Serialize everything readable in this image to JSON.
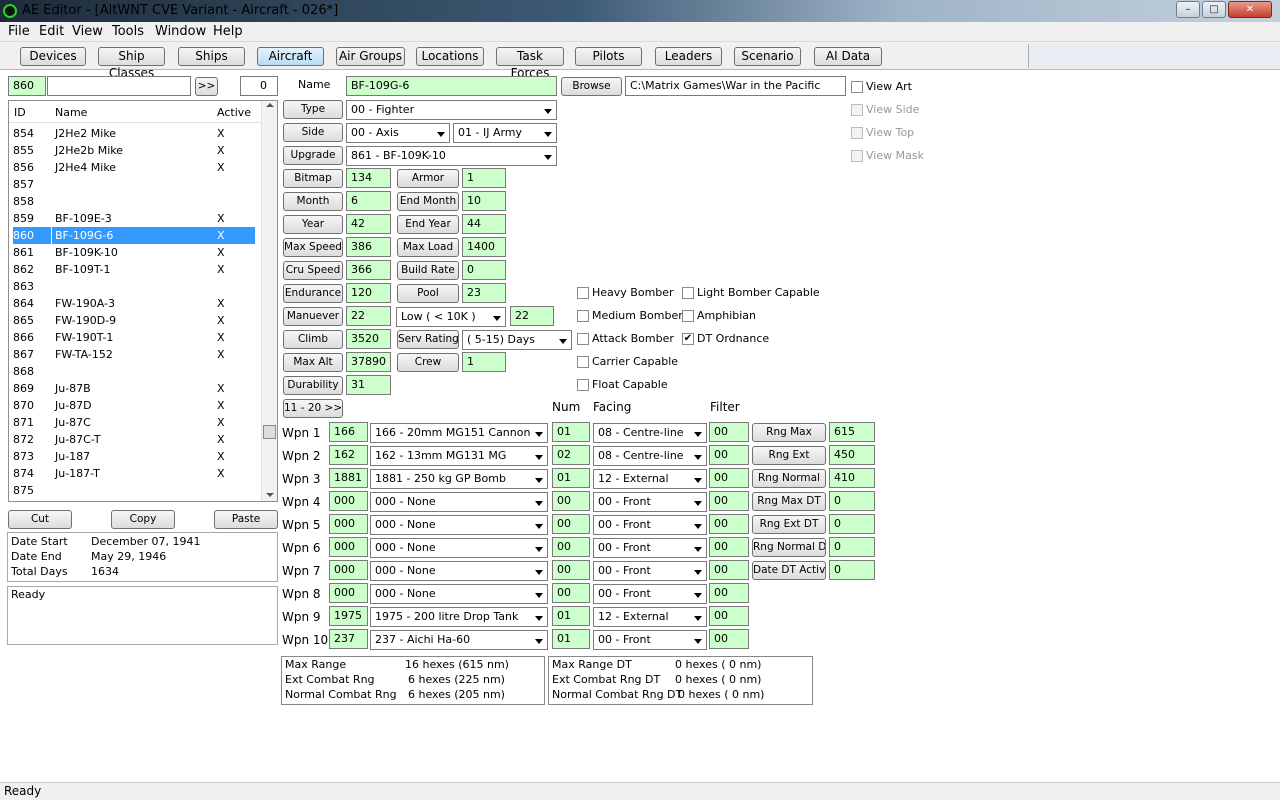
{
  "window": {
    "title": "AE Editor - [AltWNT CVE Variant - Aircraft - 026*]"
  },
  "menu": [
    "File",
    "Edit",
    "View",
    "Tools",
    "Window",
    "Help"
  ],
  "toolbar": [
    "Devices",
    "Ship Classes",
    "Ships",
    "Aircraft",
    "Air Groups",
    "Locations",
    "Task Forces",
    "Pilots",
    "Leaders",
    "Scenario",
    "AI Data"
  ],
  "toolbar_active": "Aircraft",
  "search": {
    "id_value": "860",
    "text": "",
    "go_label": ">>",
    "count": "0"
  },
  "list": {
    "headers": [
      "ID",
      "Name",
      "Active"
    ],
    "rows": [
      {
        "id": "854",
        "name": "J2He2 Mike",
        "active": "X"
      },
      {
        "id": "855",
        "name": "J2He2b Mike",
        "active": "X"
      },
      {
        "id": "856",
        "name": "J2He4 Mike",
        "active": "X"
      },
      {
        "id": "857",
        "name": "",
        "active": ""
      },
      {
        "id": "858",
        "name": "",
        "active": ""
      },
      {
        "id": "859",
        "name": "BF-109E-3",
        "active": "X"
      },
      {
        "id": "860",
        "name": "BF-109G-6",
        "active": "X"
      },
      {
        "id": "861",
        "name": "BF-109K-10",
        "active": "X"
      },
      {
        "id": "862",
        "name": "BF-109T-1",
        "active": "X"
      },
      {
        "id": "863",
        "name": "",
        "active": ""
      },
      {
        "id": "864",
        "name": "FW-190A-3",
        "active": "X"
      },
      {
        "id": "865",
        "name": "FW-190D-9",
        "active": "X"
      },
      {
        "id": "866",
        "name": "FW-190T-1",
        "active": "X"
      },
      {
        "id": "867",
        "name": "FW-TA-152",
        "active": "X"
      },
      {
        "id": "868",
        "name": "",
        "active": ""
      },
      {
        "id": "869",
        "name": "Ju-87B",
        "active": "X"
      },
      {
        "id": "870",
        "name": "Ju-87D",
        "active": "X"
      },
      {
        "id": "871",
        "name": "Ju-87C",
        "active": "X"
      },
      {
        "id": "872",
        "name": "Ju-87C-T",
        "active": "X"
      },
      {
        "id": "873",
        "name": "Ju-187",
        "active": "X"
      },
      {
        "id": "874",
        "name": "Ju-187-T",
        "active": "X"
      },
      {
        "id": "875",
        "name": "",
        "active": ""
      }
    ],
    "selected_id": "860"
  },
  "clipboard": {
    "cut": "Cut",
    "copy": "Copy",
    "paste": "Paste"
  },
  "dates": {
    "start_label": "Date Start",
    "start": "December 07, 1941",
    "end_label": "Date End",
    "end": "May 29, 1946",
    "total_label": "Total Days",
    "total": "1634"
  },
  "log": "Ready",
  "form": {
    "name_label": "Name",
    "name": "BF-109G-6",
    "browse": "Browse",
    "path": "C:\\Matrix Games\\War in the Pacific",
    "type_label": "Type",
    "type": "00 - Fighter",
    "side_label": "Side",
    "side": "00 - Axis",
    "service": "01 - IJ Army",
    "upgrade_label": "Upgrade",
    "upgrade": "861 - BF-109K-10",
    "bitmap_label": "Bitmap",
    "bitmap": "134",
    "armor_label": "Armor",
    "armor": "1",
    "month_label": "Month",
    "month": "6",
    "end_month_label": "End Month",
    "end_month": "10",
    "year_label": "Year",
    "year": "42",
    "end_year_label": "End Year",
    "end_year": "44",
    "max_speed_label": "Max Speed",
    "max_speed": "386",
    "max_load_label": "Max Load",
    "max_load": "1400",
    "cru_speed_label": "Cru Speed",
    "cru_speed": "366",
    "build_rate_label": "Build Rate",
    "build_rate": "0",
    "endurance_label": "Endurance",
    "endurance": "120",
    "pool_label": "Pool",
    "pool": "23",
    "manuever_label": "Manuever",
    "manuever": "22",
    "alt_band": "Low    ( < 10K )",
    "alt_band_value": "22",
    "climb_label": "Climb",
    "climb": "3520",
    "serv_rating_label": "Serv Rating",
    "serv_rating": "( 5-15)  Days",
    "max_alt_label": "Max Alt",
    "max_alt": "37890",
    "crew_label": "Crew",
    "crew": "1",
    "durability_label": "Durability",
    "durability": "31",
    "page_button": "11 - 20 >>"
  },
  "view_options": [
    {
      "label": "View Art",
      "checked": false,
      "enabled": true
    },
    {
      "label": "View Side",
      "checked": false,
      "enabled": false
    },
    {
      "label": "View Top",
      "checked": false,
      "enabled": false
    },
    {
      "label": "View Mask",
      "checked": false,
      "enabled": false
    }
  ],
  "capabilities_left": [
    {
      "label": "Heavy Bomber",
      "checked": false
    },
    {
      "label": "Medium Bomber",
      "checked": false
    },
    {
      "label": "Attack Bomber",
      "checked": false
    },
    {
      "label": "Carrier Capable",
      "checked": false
    },
    {
      "label": "Float Capable",
      "checked": false
    }
  ],
  "capabilities_right": [
    {
      "label": "Light Bomber Capable",
      "checked": false
    },
    {
      "label": "Amphibian",
      "checked": false
    },
    {
      "label": "DT Ordnance",
      "checked": true
    }
  ],
  "weapons_headers": {
    "num": "Num",
    "facing": "Facing",
    "filter": "Filter"
  },
  "weapons": [
    {
      "label": "Wpn 1",
      "id": "166",
      "device": "166 - 20mm MG151 Cannon",
      "num": "01",
      "facing": "08 - Centre-line",
      "filter": "00"
    },
    {
      "label": "Wpn 2",
      "id": "162",
      "device": "162 - 13mm MG131 MG",
      "num": "02",
      "facing": "08 - Centre-line",
      "filter": "00"
    },
    {
      "label": "Wpn 3",
      "id": "1881",
      "device": "1881 - 250 kg GP Bomb",
      "num": "01",
      "facing": "12 - External",
      "filter": "00"
    },
    {
      "label": "Wpn 4",
      "id": "000",
      "device": "000 - None",
      "num": "00",
      "facing": "00 - Front",
      "filter": "00"
    },
    {
      "label": "Wpn 5",
      "id": "000",
      "device": "000 - None",
      "num": "00",
      "facing": "00 - Front",
      "filter": "00"
    },
    {
      "label": "Wpn 6",
      "id": "000",
      "device": "000 - None",
      "num": "00",
      "facing": "00 - Front",
      "filter": "00"
    },
    {
      "label": "Wpn 7",
      "id": "000",
      "device": "000 - None",
      "num": "00",
      "facing": "00 - Front",
      "filter": "00"
    },
    {
      "label": "Wpn 8",
      "id": "000",
      "device": "000 - None",
      "num": "00",
      "facing": "00 - Front",
      "filter": "00"
    },
    {
      "label": "Wpn 9",
      "id": "1975",
      "device": "1975 - 200 litre Drop Tank",
      "num": "01",
      "facing": "12 - External",
      "filter": "00"
    },
    {
      "label": "Wpn 10",
      "id": "237",
      "device": "237 - Aichi Ha-60",
      "num": "01",
      "facing": "00 - Front",
      "filter": "00"
    }
  ],
  "ranges": [
    {
      "label": "Rng Max",
      "value": "615"
    },
    {
      "label": "Rng Ext",
      "value": "450"
    },
    {
      "label": "Rng Normal",
      "value": "410"
    },
    {
      "label": "Rng Max DT",
      "value": "0"
    },
    {
      "label": "Rng Ext DT",
      "value": "0"
    },
    {
      "label": "Rng Normal DT",
      "value": "0"
    },
    {
      "label": "Date DT Active",
      "value": "0"
    }
  ],
  "range_summary_left": [
    {
      "label": "Max Range",
      "value": "16 hexes (615 nm)"
    },
    {
      "label": "Ext Combat Rng",
      "value": "6 hexes (225 nm)"
    },
    {
      "label": "Normal Combat Rng",
      "value": "6 hexes (205 nm)"
    }
  ],
  "range_summary_right": [
    {
      "label": "Max Range DT",
      "value": "0 hexes ( 0 nm)"
    },
    {
      "label": "Ext Combat Rng DT",
      "value": "0 hexes ( 0 nm)"
    },
    {
      "label": "Normal Combat Rng DT",
      "value": "0 hexes ( 0 nm)"
    }
  ],
  "status": "Ready"
}
